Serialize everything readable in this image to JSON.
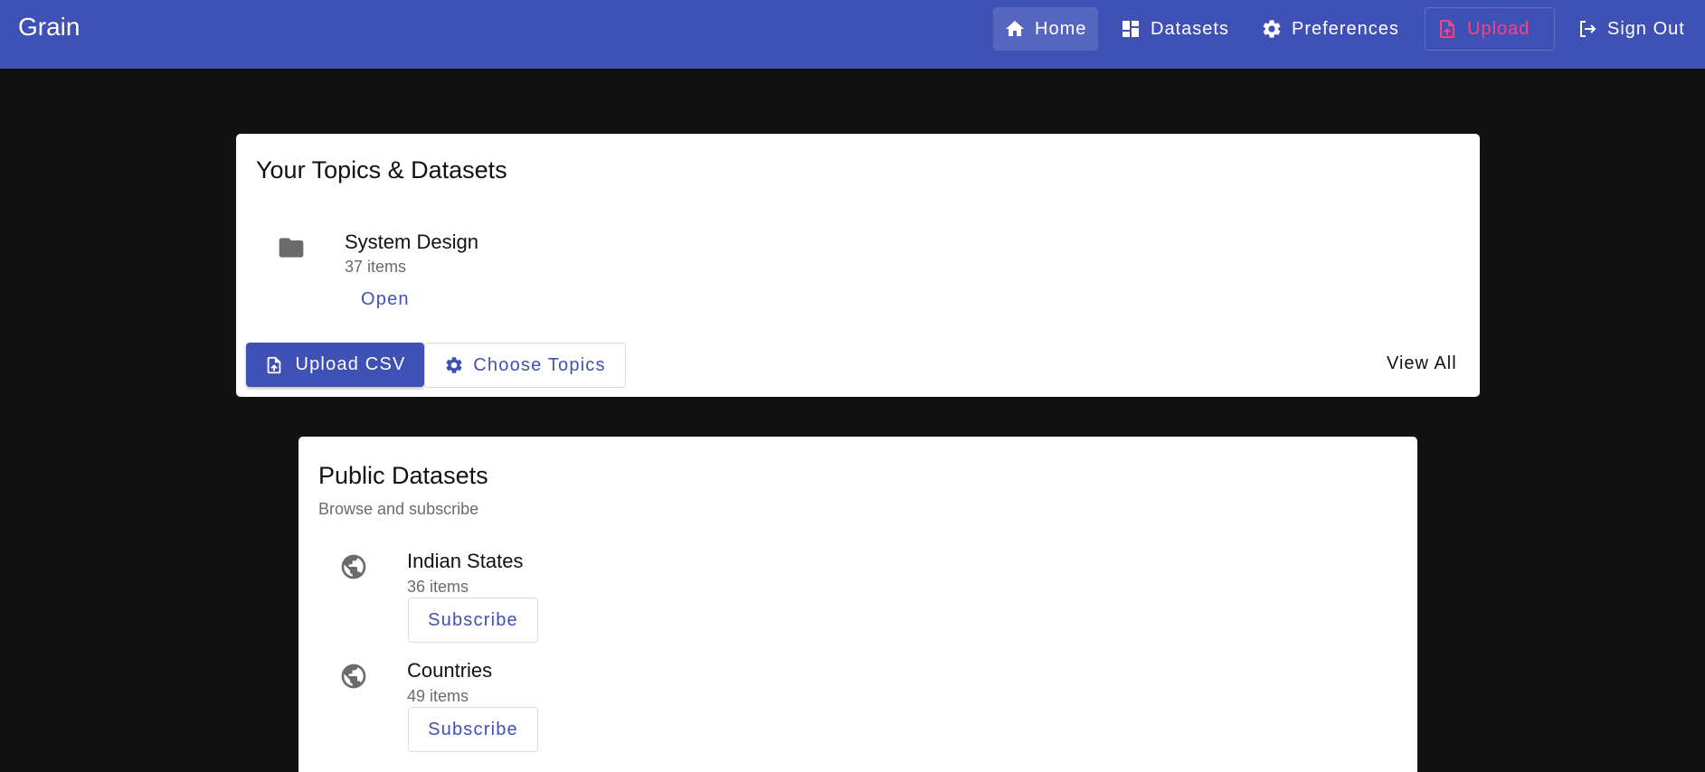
{
  "app": {
    "title": "Grain"
  },
  "nav": {
    "home": {
      "label": "Home",
      "icon": "home-icon"
    },
    "datasets": {
      "label": "Datasets",
      "icon": "dashboard-icon"
    },
    "preferences": {
      "label": "Preferences",
      "icon": "gear-icon"
    },
    "upload": {
      "label": "Upload",
      "icon": "upload-file-icon"
    },
    "signout": {
      "label": "Sign Out",
      "icon": "logout-icon"
    }
  },
  "topics": {
    "title": "Your Topics & Datasets",
    "items": [
      {
        "name": "System Design",
        "count": "37 items",
        "action": "Open",
        "icon": "folder-icon"
      }
    ],
    "upload_csv_label": "Upload CSV",
    "choose_topics_label": "Choose Topics",
    "view_all_label": "View All"
  },
  "public": {
    "title": "Public Datasets",
    "subtitle": "Browse and subscribe",
    "items": [
      {
        "name": "Indian States",
        "count": "36 items",
        "action": "Subscribe",
        "icon": "globe-icon"
      },
      {
        "name": "Countries",
        "count": "49 items",
        "action": "Subscribe",
        "icon": "globe-icon"
      }
    ]
  },
  "colors": {
    "primary": "#3f51b5",
    "accent": "#ff4081",
    "background": "#121212"
  }
}
